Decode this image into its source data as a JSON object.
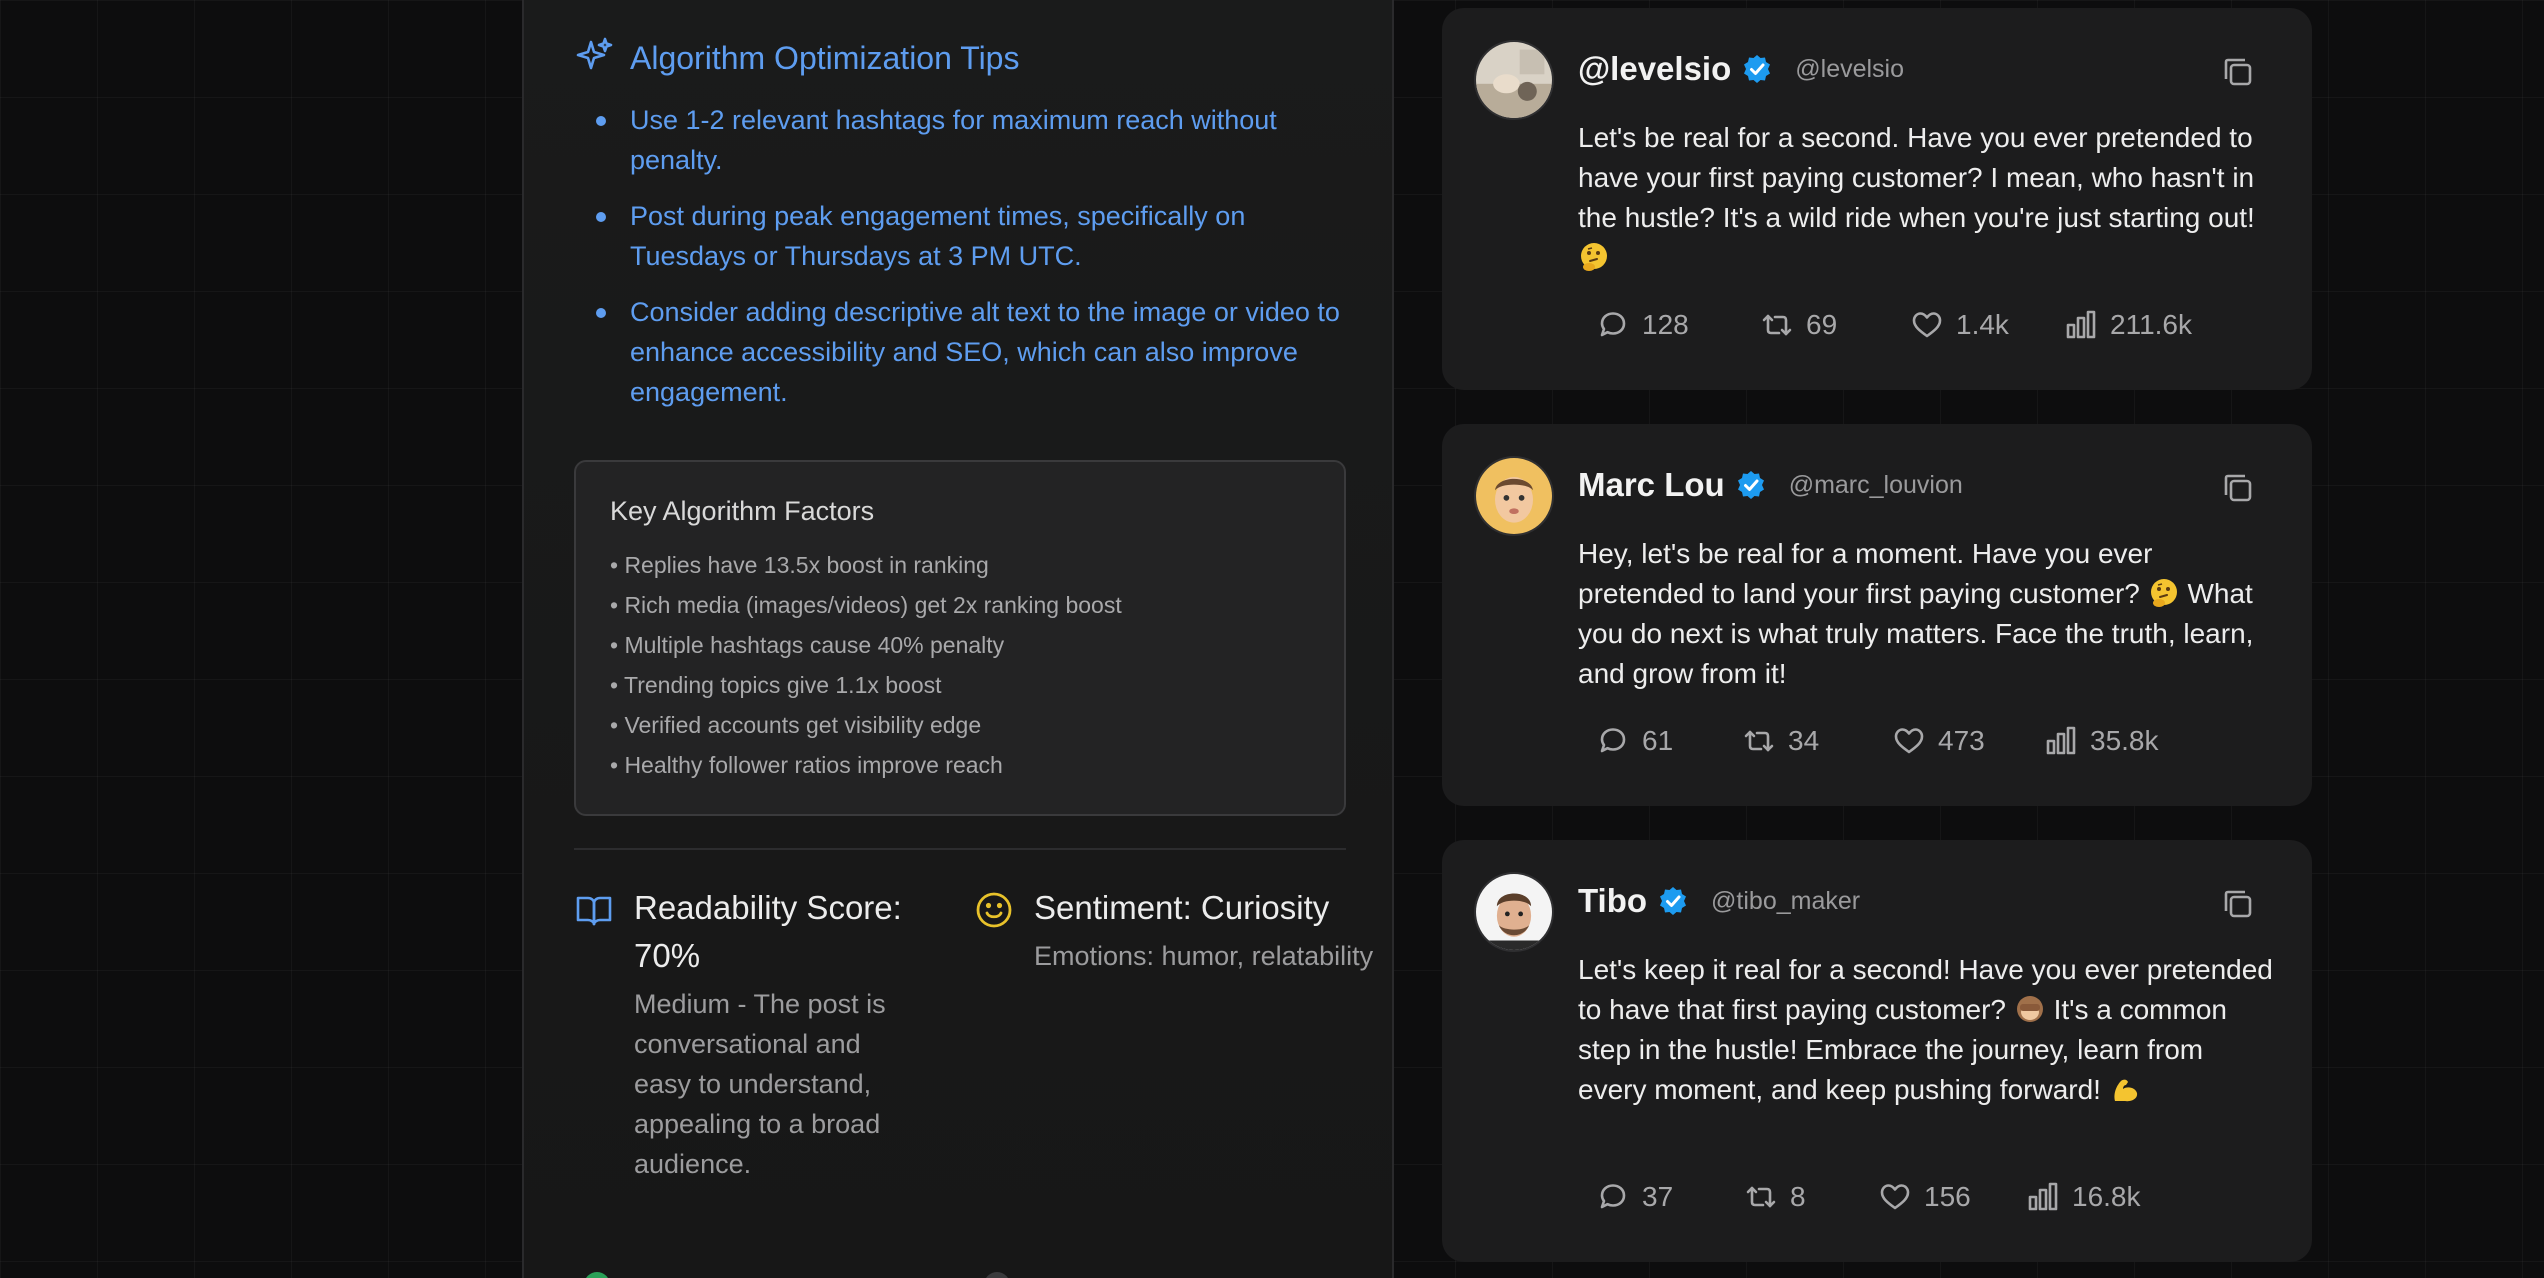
{
  "tips": {
    "title": "Algorithm Optimization Tips",
    "items": [
      "Use 1-2 relevant hashtags for maximum reach without penalty.",
      "Post during peak engagement times, specifically on Tuesdays or Thursdays at 3 PM UTC.",
      "Consider adding descriptive alt text to the image or video to enhance accessibility and SEO, which can also improve engagement."
    ]
  },
  "factors": {
    "title": "Key Algorithm Factors",
    "items": [
      "• Replies have 13.5x boost in ranking",
      "• Rich media (images/videos) get 2x ranking boost",
      "• Multiple hashtags cause 40% penalty",
      "• Trending topics give 1.1x boost",
      "• Verified accounts get visibility edge",
      "• Healthy follower ratios improve reach"
    ]
  },
  "readability": {
    "title": "Readability Score: 70%",
    "description": "Medium - The post is conversational and easy to understand, appealing to a broad audience."
  },
  "sentiment": {
    "title": "Sentiment: Curiosity",
    "description": "Emotions: humor, relatability"
  },
  "tweets": [
    {
      "name": "@levelsio",
      "handle": "@levelsio",
      "text": "Let's be real for a second. Have you ever pretended to have your first paying customer? I mean, who hasn't in the hustle? It's a wild ride when you're just starting out!",
      "emoji": "thinking-face",
      "replies": "128",
      "reposts": "69",
      "likes": "1.4k",
      "views": "211.6k"
    },
    {
      "name": "Marc Lou",
      "handle": "@marc_louvion",
      "text_a": "Hey, let's be real for a moment. Have you ever pretended to land your first paying customer?",
      "text_b": "What you do next is what truly matters. Face the truth, learn, and grow from it!",
      "emoji": "thinking-face",
      "replies": "61",
      "reposts": "34",
      "likes": "473",
      "views": "35.8k"
    },
    {
      "name": "Tibo",
      "handle": "@tibo_maker",
      "text_a": "Let's keep it real for a second! Have you ever pretended to have that first paying customer?",
      "text_b": "It's a common step in the hustle! Embrace the journey, learn from every moment, and keep pushing forward!",
      "emoji_a": "see-no-evil-monkey",
      "emoji_b": "flexed-biceps",
      "replies": "37",
      "reposts": "8",
      "likes": "156",
      "views": "16.8k"
    }
  ],
  "colors": {
    "accent_blue": "#5e9df0",
    "verified_blue": "#1d9bf0",
    "sentiment_yellow": "#e8c22a"
  }
}
